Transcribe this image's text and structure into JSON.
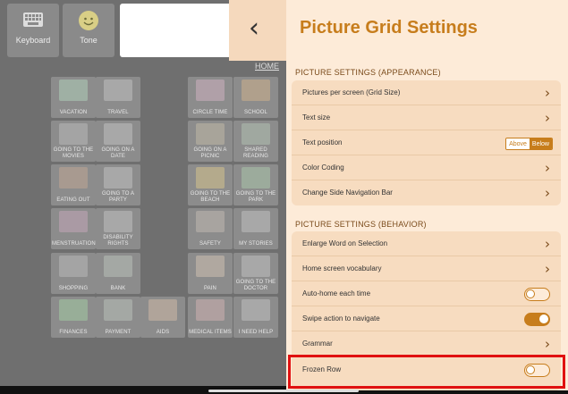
{
  "toolbar": {
    "keyboard_label": "Keyboard",
    "tone_label": "Tone",
    "home_link": "HOME"
  },
  "tiles": [
    {
      "label": "VACATION",
      "color": "#9fb0a4"
    },
    {
      "label": "TRAVEL",
      "color": "#a8a8a8"
    },
    {
      "label": "CIRCLE TIME",
      "color": "#b0a0a8"
    },
    {
      "label": "SCHOOL",
      "color": "#b0a08c"
    },
    {
      "label": "GOING TO THE MOVIES",
      "color": "#a4a4a4"
    },
    {
      "label": "GOING ON A DATE",
      "color": "#a8a8a8"
    },
    {
      "label": "GOING ON A PICNIC",
      "color": "#a8a49a"
    },
    {
      "label": "SHARED READING",
      "color": "#a0a8a0"
    },
    {
      "label": "EATING OUT",
      "color": "#a89a90"
    },
    {
      "label": "GOING TO A PARTY",
      "color": "#a8a8a8"
    },
    {
      "label": "GOING TO THE BEACH",
      "color": "#b4aa8c"
    },
    {
      "label": "GOING TO THE PARK",
      "color": "#9cab9c"
    },
    {
      "label": "MENSTRUATION",
      "color": "#aa9aa4"
    },
    {
      "label": "DISABILITY RIGHTS",
      "color": "#a8a8a8"
    },
    {
      "label": "SAFETY",
      "color": "#a8a4a0"
    },
    {
      "label": "MY STORIES",
      "color": "#a8a8a8"
    },
    {
      "label": "SHOPPING",
      "color": "#a4a4a4"
    },
    {
      "label": "BANK",
      "color": "#a4a8a4"
    },
    {
      "label": "PAIN",
      "color": "#b0a8a0"
    },
    {
      "label": "GOING TO THE DOCTOR",
      "color": "#a8a8a8"
    },
    {
      "label": "FINANCES",
      "color": "#98ae98"
    },
    {
      "label": "PAYMENT",
      "color": "#a4a8a4"
    },
    {
      "label": "AIDS",
      "color": "#b0a49a"
    },
    {
      "label": "MEDICAL ITEMS",
      "color": "#b0a0a0"
    },
    {
      "label": "I NEED HELP",
      "color": "#a8a8a8"
    }
  ],
  "panel": {
    "title": "Picture Grid Settings",
    "appearance_header": "PICTURE SETTINGS (APPEARANCE)",
    "appearance_rows": [
      {
        "label": "Pictures per screen (Grid Size)"
      },
      {
        "label": "Text size"
      },
      {
        "label": "Text position",
        "options": [
          "Above",
          "Below"
        ],
        "selected": "Below"
      },
      {
        "label": "Color Coding"
      },
      {
        "label": "Change Side Navigation Bar"
      }
    ],
    "behavior_header": "PICTURE SETTINGS (BEHAVIOR)",
    "behavior_rows": [
      {
        "label": "Enlarge Word on Selection",
        "control": "chevron"
      },
      {
        "label": "Home screen vocabulary",
        "control": "chevron"
      },
      {
        "label": "Auto-home each time",
        "control": "toggle",
        "value": false
      },
      {
        "label": "Swipe action to navigate",
        "control": "toggle",
        "value": true
      },
      {
        "label": "Grammar",
        "control": "chevron"
      },
      {
        "label": "Frozen Row",
        "control": "toggle",
        "value": false
      }
    ]
  },
  "colors": {
    "accent": "#c77d1c",
    "panel_bg": "#fdebd8",
    "card_bg": "#f7dcc0",
    "highlight": "#e01010"
  }
}
